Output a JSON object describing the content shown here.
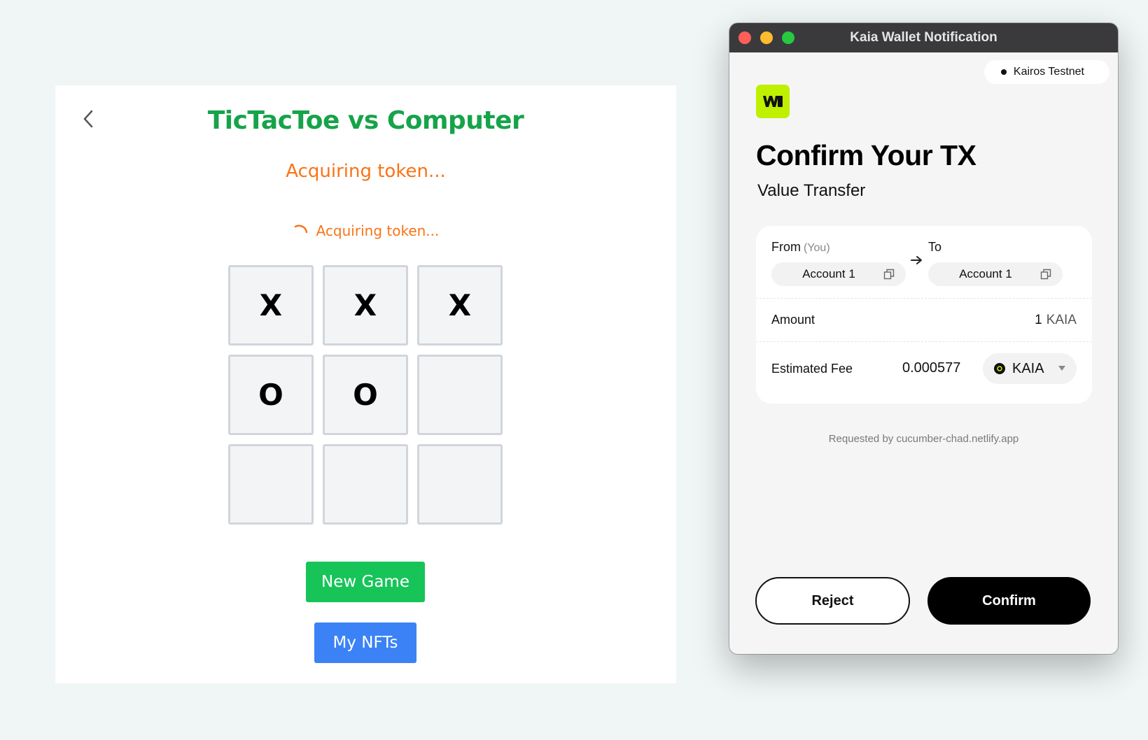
{
  "game": {
    "title": "TicTacToe vs Computer",
    "status": "Acquiring token...",
    "loading_text": "Acquiring token...",
    "board": [
      "X",
      "X",
      "X",
      "O",
      "O",
      "",
      "",
      "",
      ""
    ],
    "new_game_label": "New Game",
    "my_nfts_label": "My NFTs",
    "colors": {
      "title": "#16a34a",
      "status": "#f97316",
      "new_game": "#16c458",
      "my_nfts": "#3b82f6"
    }
  },
  "wallet": {
    "window_title": "Kaia Wallet Notification",
    "network": "Kairos Testnet",
    "heading": "Confirm Your TX",
    "tx_type": "Value Transfer",
    "from_label": "From",
    "from_tag": "(You)",
    "to_label": "To",
    "from_account": "Account 1",
    "to_account": "Account 1",
    "amount_label": "Amount",
    "amount_value": "1",
    "amount_unit": "KAIA",
    "fee_label": "Estimated Fee",
    "fee_value": "0.000577",
    "fee_token": "KAIA",
    "requested_by": "Requested by cucumber-chad.netlify.app",
    "reject_label": "Reject",
    "confirm_label": "Confirm",
    "colors": {
      "logo_bg": "#bff000",
      "titlebar": "#3a3a3c"
    }
  },
  "icons": [
    "chevron-left-icon",
    "spinner-icon",
    "arrow-right-icon",
    "copy-icon",
    "kaia-coin-icon",
    "caret-down-icon",
    "wallet-logo-icon"
  ]
}
